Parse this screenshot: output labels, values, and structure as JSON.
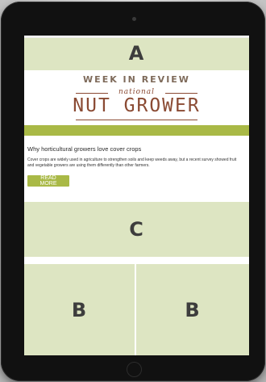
{
  "ads": {
    "top": "A",
    "middle": "C",
    "bottom_left": "B",
    "bottom_right": "B"
  },
  "header": {
    "kicker": "WEEK IN REVIEW",
    "logo_script": "national",
    "logo_main": "NUT GROWER"
  },
  "article": {
    "headline": "Why horticultural growers love cover crops",
    "excerpt": "Cover crops are widely used in agriculture to strengthen soils and keep weeds away, but a recent survey showed fruit and vegetable growers are using them differently than other farmers.",
    "read_more": "READ MORE"
  },
  "colors": {
    "accent_green": "#a9b946",
    "ad_placeholder": "#dde5c2",
    "brand_brown": "#8a4a33"
  }
}
